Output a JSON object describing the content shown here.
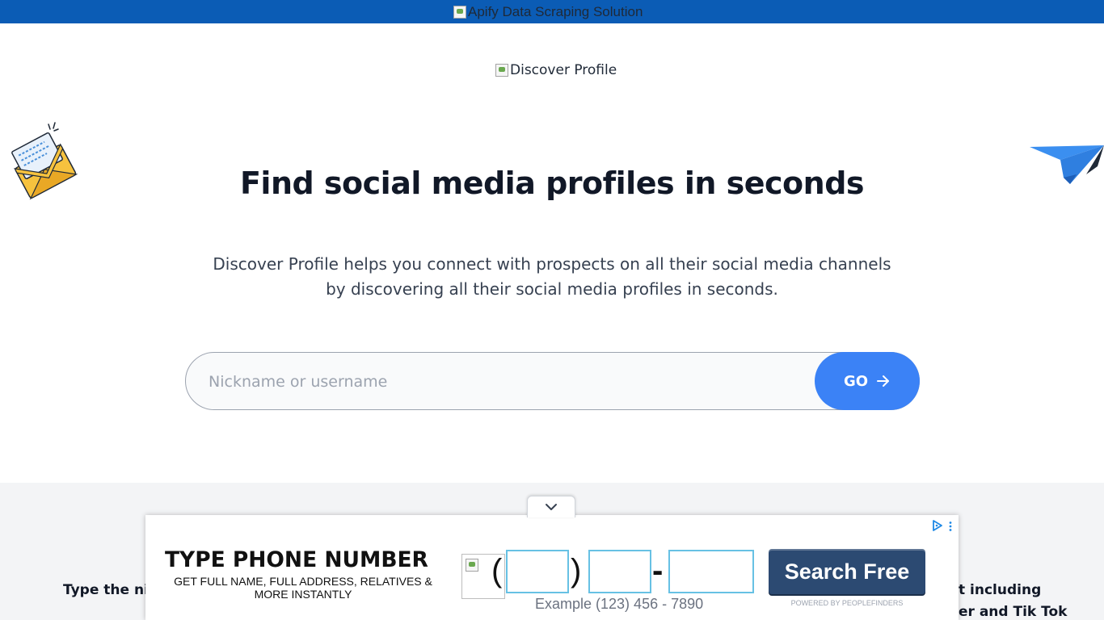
{
  "banner": {
    "image_alt": "Apify Data Scraping Solution",
    "background_color": "#0b5cb5"
  },
  "logo": {
    "image_alt": "Discover Profile"
  },
  "hero": {
    "title": "Find social media profiles in seconds",
    "subtitle_line1": "Discover Profile helps you connect with prospects on all their social media channels",
    "subtitle_line2": "by discovering all their social media profiles in seconds."
  },
  "search": {
    "placeholder": "Nickname or username",
    "value": "",
    "go_label": "GO",
    "button_color": "#3b82f6"
  },
  "lower": {
    "left_text": "Type the nick",
    "right_text_line1": "t including",
    "right_text_line2": "er and Tik Tok"
  },
  "ad": {
    "headline": "TYPE PHONE NUMBER",
    "subline": "GET FULL NAME, FULL ADDRESS, RELATIVES & MORE INSTANTLY",
    "open_paren": "(",
    "close_paren": ")",
    "dash": "-",
    "example": "Example (123) 456 - 7890",
    "button_label": "Search Free",
    "powered_by": "POWERED BY PEOPLEFINDERS",
    "icons": [
      "chevron-down-icon",
      "adchoices-icon",
      "more-vertical-icon"
    ]
  }
}
